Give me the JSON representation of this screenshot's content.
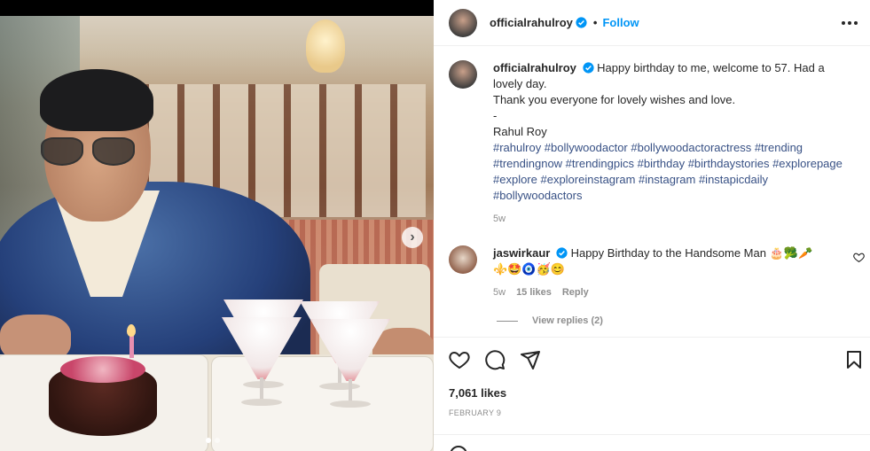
{
  "post": {
    "username": "officialrahulroy",
    "follow_label": "Follow",
    "separator": "•"
  },
  "caption": {
    "username": "officialrahulroy",
    "line1": "Happy birthday to me, welcome to 57. Had a lovely day.",
    "line2": "Thank you everyone for lovely wishes and love.",
    "line3": "-",
    "line4": "Rahul Roy",
    "hashtags": "#rahulroy #bollywoodactor #bollywoodactoractress #trending #trendingnow #trendingpics #birthday #birthdaystories #explorepage #explore #exploreinstagram #instagram #instapicdaily #bollywoodactors",
    "time": "5w"
  },
  "comment": {
    "username": "jaswirkaur",
    "text": "Happy Birthday to the Handsome Man",
    "emojis_inline": "🎂🥦🥕",
    "emojis_row": "⚜️🤩🧿🥳😊",
    "time": "5w",
    "likes": "15 likes",
    "reply_label": "Reply"
  },
  "view_replies": "View replies (2)",
  "likes_count": "7,061 likes",
  "date": "FEBRUARY 9",
  "icons": {
    "verified": "verified-badge-icon",
    "more": "more-options-icon",
    "like": "heart-icon",
    "comment": "comment-bubble-icon",
    "share": "paper-plane-icon",
    "save": "bookmark-icon",
    "next": "chevron-right-icon"
  },
  "colors": {
    "accent": "#0095f6",
    "hashtag": "#385185",
    "muted": "#8e8e8e",
    "text": "#262626"
  },
  "carousel": {
    "slide_count": 2,
    "active_slide": 1
  }
}
